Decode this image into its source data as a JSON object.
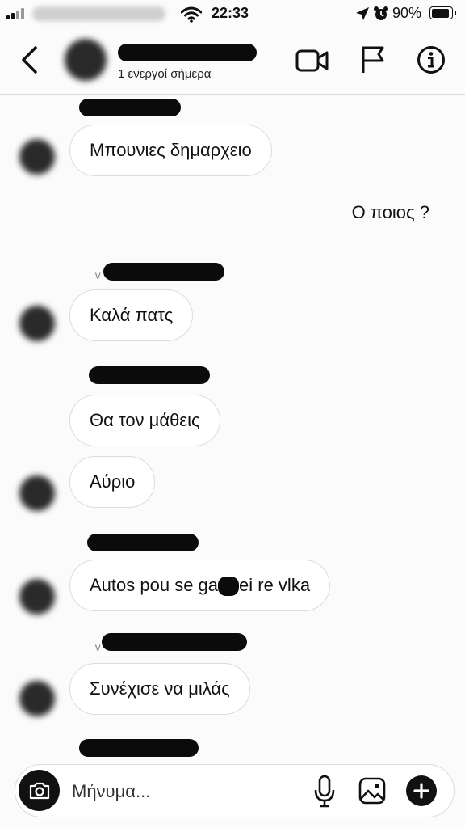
{
  "status_bar": {
    "time": "22:33",
    "battery": "90%",
    "icons": [
      "signal-icon",
      "wifi-icon",
      "location-arrow-icon",
      "alarm-icon",
      "battery-icon"
    ]
  },
  "header": {
    "active_status": "1 ενεργοί σήμερα",
    "icons": [
      "back-chevron-icon",
      "video-call-icon",
      "flag-icon",
      "info-icon"
    ]
  },
  "messages": [
    {
      "direction": "received",
      "text": "Μπουνιες δημαρχειο"
    },
    {
      "direction": "sent",
      "text": "Ο ποιος ?"
    },
    {
      "direction": "received",
      "text": "Καλά πατς"
    },
    {
      "direction": "received",
      "text": "Θα τον μάθεις"
    },
    {
      "direction": "received",
      "text": "Αύριο"
    },
    {
      "direction": "received",
      "text": "Autos pou se ga",
      "text_after_redaction": "ei re vlka"
    },
    {
      "direction": "received",
      "text": "Συνέχισε να μιλάς"
    }
  ],
  "composer": {
    "placeholder": "Μήνυμα...",
    "icons": [
      "camera-icon",
      "microphone-icon",
      "gallery-icon",
      "plus-icon"
    ]
  },
  "colors": {
    "background": "#fbfbfb",
    "bubble_border": "#dcdcdc",
    "text": "#111111"
  }
}
